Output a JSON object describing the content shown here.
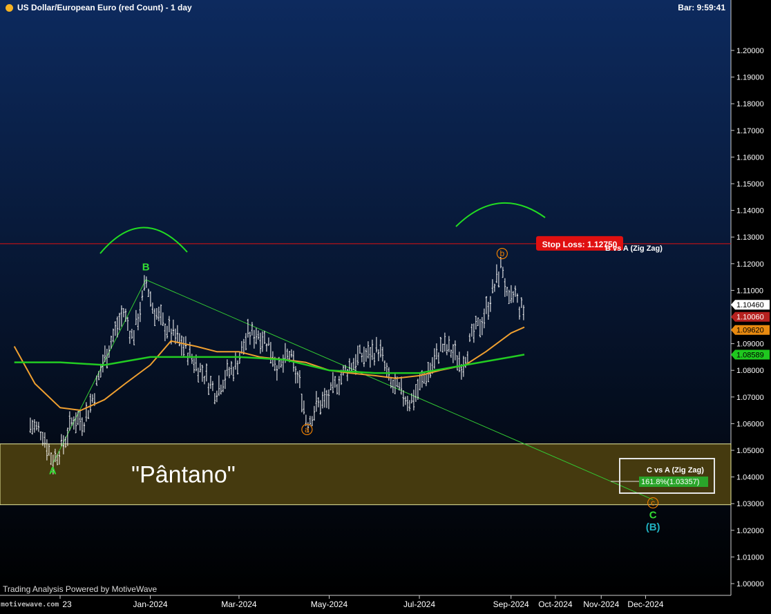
{
  "header": {
    "title": "US Dollar/European Euro (red Count) - 1 day",
    "bar_time": "Bar: 9:59:41"
  },
  "footer": {
    "credit": "Trading Analysis Powered by MotiveWave",
    "watermark": "motivewave.com"
  },
  "colors": {
    "background_top": "#0d2a5e",
    "background_bottom": "#000000",
    "price_bars": "#ffffff",
    "orange_ma": "#f0a030",
    "green_ma": "#22cc22",
    "zigzag": "#33cc33",
    "stop_loss": "#e01010",
    "zone_fill": "#453a0f",
    "zone_border": "#f0f0a0",
    "wave_orange": "#f08000",
    "wave_cyan": "#20b0c0"
  },
  "chart_data": {
    "type": "line",
    "title": "US Dollar/European Euro (red Count) - 1 day",
    "xlabel": "",
    "ylabel": "",
    "ylim": [
      0.995,
      1.2077
    ],
    "y_ticks": [
      "1.20000",
      "1.19000",
      "1.18000",
      "1.17000",
      "1.16000",
      "1.15000",
      "1.14000",
      "1.13000",
      "1.12000",
      "1.11000",
      "1.10000",
      "1.09000",
      "1.08000",
      "1.07000",
      "1.06000",
      "1.05000",
      "1.04000",
      "1.03000",
      "1.02000",
      "1.01000",
      "1.00000"
    ],
    "x_ticks": [
      {
        "label": "Nov-2023",
        "date": "2023-11-01"
      },
      {
        "label": "Jan-2024",
        "date": "2024-01-01"
      },
      {
        "label": "Mar-2024",
        "date": "2024-03-01"
      },
      {
        "label": "May-2024",
        "date": "2024-05-01"
      },
      {
        "label": "Jul-2024",
        "date": "2024-07-01"
      },
      {
        "label": "Sep-2024",
        "date": "2024-09-01"
      },
      {
        "label": "Oct-2024",
        "date": "2024-10-01"
      },
      {
        "label": "Nov-2024",
        "date": "2024-11-01"
      },
      {
        "label": "Dec-2024",
        "date": "2024-12-01"
      }
    ],
    "x_tick_first_visible": "23",
    "price_series": {
      "name": "EUR/USD daily",
      "points": [
        [
          "2023-10-10",
          1.06
        ],
        [
          "2023-10-20",
          1.057
        ],
        [
          "2023-10-27",
          1.046
        ],
        [
          "2023-11-03",
          1.052
        ],
        [
          "2023-11-10",
          1.062
        ],
        [
          "2023-11-17",
          1.061
        ],
        [
          "2023-11-24",
          1.071
        ],
        [
          "2023-11-30",
          1.083
        ],
        [
          "2023-12-07",
          1.093
        ],
        [
          "2023-12-14",
          1.102
        ],
        [
          "2023-12-20",
          1.092
        ],
        [
          "2023-12-27",
          1.107
        ],
        [
          "2023-12-29",
          1.114
        ],
        [
          "2024-01-03",
          1.103
        ],
        [
          "2024-01-10",
          1.097
        ],
        [
          "2024-01-17",
          1.093
        ],
        [
          "2024-01-24",
          1.089
        ],
        [
          "2024-01-31",
          1.083
        ],
        [
          "2024-02-07",
          1.078
        ],
        [
          "2024-02-14",
          1.072
        ],
        [
          "2024-02-21",
          1.078
        ],
        [
          "2024-02-28",
          1.082
        ],
        [
          "2024-03-07",
          1.093
        ],
        [
          "2024-03-14",
          1.094
        ],
        [
          "2024-03-21",
          1.09
        ],
        [
          "2024-03-28",
          1.08
        ],
        [
          "2024-04-04",
          1.086
        ],
        [
          "2024-04-11",
          1.075
        ],
        [
          "2024-04-16",
          1.06
        ],
        [
          "2024-04-23",
          1.067
        ],
        [
          "2024-04-30",
          1.069
        ],
        [
          "2024-05-07",
          1.076
        ],
        [
          "2024-05-14",
          1.081
        ],
        [
          "2024-05-21",
          1.085
        ],
        [
          "2024-05-28",
          1.086
        ],
        [
          "2024-06-04",
          1.088
        ],
        [
          "2024-06-11",
          1.075
        ],
        [
          "2024-06-18",
          1.072
        ],
        [
          "2024-06-25",
          1.068
        ],
        [
          "2024-07-02",
          1.075
        ],
        [
          "2024-07-09",
          1.081
        ],
        [
          "2024-07-16",
          1.089
        ],
        [
          "2024-07-23",
          1.087
        ],
        [
          "2024-07-30",
          1.082
        ],
        [
          "2024-08-06",
          1.093
        ],
        [
          "2024-08-13",
          1.099
        ],
        [
          "2024-08-20",
          1.11
        ],
        [
          "2024-08-26",
          1.12
        ],
        [
          "2024-08-30",
          1.104
        ],
        [
          "2024-09-04",
          1.109
        ],
        [
          "2024-09-06",
          1.104
        ],
        [
          "2024-09-10",
          1.102
        ]
      ]
    },
    "moving_averages": [
      {
        "color": "#f0a030",
        "last_value": 1.0962,
        "points": [
          [
            "2023-10-01",
            1.089
          ],
          [
            "2023-10-15",
            1.075
          ],
          [
            "2023-11-01",
            1.066
          ],
          [
            "2023-11-15",
            1.065
          ],
          [
            "2023-12-01",
            1.069
          ],
          [
            "2023-12-15",
            1.075
          ],
          [
            "2024-01-01",
            1.082
          ],
          [
            "2024-01-15",
            1.091
          ],
          [
            "2024-02-01",
            1.089
          ],
          [
            "2024-02-15",
            1.087
          ],
          [
            "2024-03-01",
            1.087
          ],
          [
            "2024-03-15",
            1.085
          ],
          [
            "2024-04-01",
            1.084
          ],
          [
            "2024-04-15",
            1.083
          ],
          [
            "2024-05-01",
            1.08
          ],
          [
            "2024-05-15",
            1.079
          ],
          [
            "2024-06-01",
            1.078
          ],
          [
            "2024-06-15",
            1.077
          ],
          [
            "2024-07-01",
            1.078
          ],
          [
            "2024-07-15",
            1.08
          ],
          [
            "2024-08-01",
            1.082
          ],
          [
            "2024-08-15",
            1.087
          ],
          [
            "2024-09-01",
            1.094
          ],
          [
            "2024-09-10",
            1.0962
          ]
        ]
      },
      {
        "color": "#22cc22",
        "last_value": 1.08589,
        "points": [
          [
            "2023-10-01",
            1.083
          ],
          [
            "2023-11-01",
            1.083
          ],
          [
            "2023-12-01",
            1.082
          ],
          [
            "2024-01-01",
            1.085
          ],
          [
            "2024-02-01",
            1.085
          ],
          [
            "2024-03-01",
            1.085
          ],
          [
            "2024-04-01",
            1.084
          ],
          [
            "2024-05-01",
            1.08
          ],
          [
            "2024-06-01",
            1.079
          ],
          [
            "2024-07-01",
            1.079
          ],
          [
            "2024-08-01",
            1.082
          ],
          [
            "2024-09-01",
            1.085
          ],
          [
            "2024-09-10",
            1.0859
          ]
        ]
      }
    ],
    "zigzag": [
      [
        "2023-10-27",
        1.045
      ],
      [
        "2023-12-29",
        1.114
      ],
      [
        "2024-12-06",
        1.0315
      ]
    ],
    "horizontal_lines": [
      {
        "label": "Stop Loss: 1.12750",
        "value": 1.1275
      }
    ],
    "zone": {
      "label": "\"Pântano\"",
      "from": 1.0296,
      "to": 1.0524
    },
    "last_value_labels": [
      {
        "text": "1.10460",
        "value": 1.1046,
        "style": "white"
      },
      {
        "text": "1.10060",
        "value": 1.1006,
        "style": "red"
      },
      {
        "text": "1.09620",
        "value": 1.0962,
        "style": "orange"
      },
      {
        "text": "1.08589",
        "value": 1.08589,
        "style": "green"
      }
    ],
    "wave_labels": [
      {
        "text": "A",
        "date": "2023-10-27",
        "value": 1.041,
        "color": "#33dd33"
      },
      {
        "text": "B",
        "date": "2023-12-29",
        "value": 1.1175,
        "color": "#33dd33"
      },
      {
        "text": "a",
        "date": "2024-04-16",
        "value": 1.0565,
        "color": "#f08000",
        "circled": true
      },
      {
        "text": "b",
        "date": "2024-08-26",
        "value": 1.1225,
        "color": "#f08000",
        "circled": true
      },
      {
        "text": "c",
        "date": "2024-12-06",
        "value": 1.029,
        "color": "#f08000",
        "circled": true
      },
      {
        "text": "C",
        "date": "2024-12-06",
        "value": 1.0245,
        "color": "#33dd33"
      },
      {
        "text": "(B)",
        "date": "2024-12-06",
        "value": 1.02,
        "color": "#20b0c0"
      }
    ],
    "annotations": [
      {
        "text": "B vs A (Zig Zag)"
      },
      {
        "text": "C vs A (Zig Zag)"
      },
      {
        "text": "161.8%(1.03357)"
      }
    ]
  }
}
